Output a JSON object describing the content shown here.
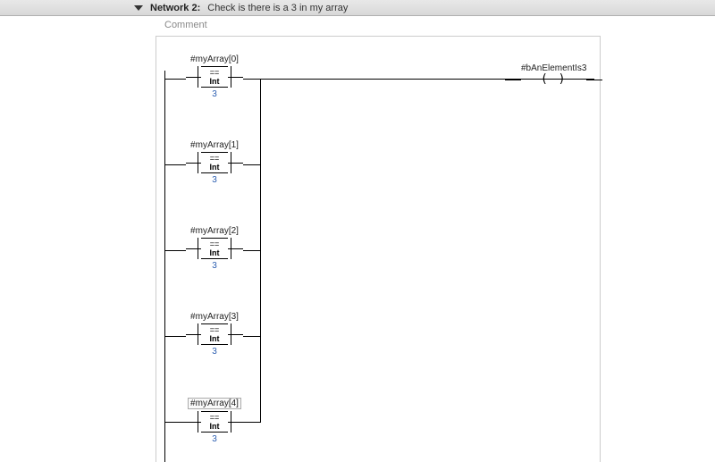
{
  "header": {
    "title": "Network 2:",
    "description": "Check is there is a 3 in my array"
  },
  "comment": {
    "placeholder": "Comment"
  },
  "coil": {
    "tag": "#bAnElementIs3"
  },
  "compare": {
    "op": "==",
    "type": "Int"
  },
  "rungs": [
    {
      "tag": "#myArray[0]",
      "value": "3",
      "boxed": false
    },
    {
      "tag": "#myArray[1]",
      "value": "3",
      "boxed": false
    },
    {
      "tag": "#myArray[2]",
      "value": "3",
      "boxed": false
    },
    {
      "tag": "#myArray[3]",
      "value": "3",
      "boxed": false
    },
    {
      "tag": "#myArray[4]",
      "value": "3",
      "boxed": true
    }
  ]
}
